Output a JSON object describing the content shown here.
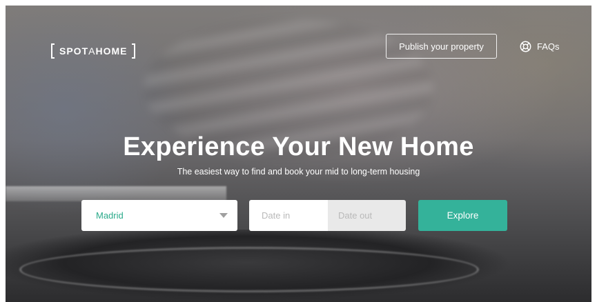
{
  "brand": {
    "bold_part_1": "SPOT",
    "thin_part": "A",
    "bold_part_2": "HOME"
  },
  "nav": {
    "publish_label": "Publish your property",
    "faq_label": "FAQs",
    "faq_icon": "lifebuoy-icon"
  },
  "hero": {
    "title": "Experience Your New Home",
    "subtitle": "The easiest way to find and book your mid to long-term housing"
  },
  "search": {
    "city_value": "Madrid",
    "date_in_placeholder": "Date in",
    "date_out_placeholder": "Date out",
    "explore_label": "Explore"
  },
  "colors": {
    "accent": "#34b29a",
    "city_text": "#2aaa8a"
  }
}
